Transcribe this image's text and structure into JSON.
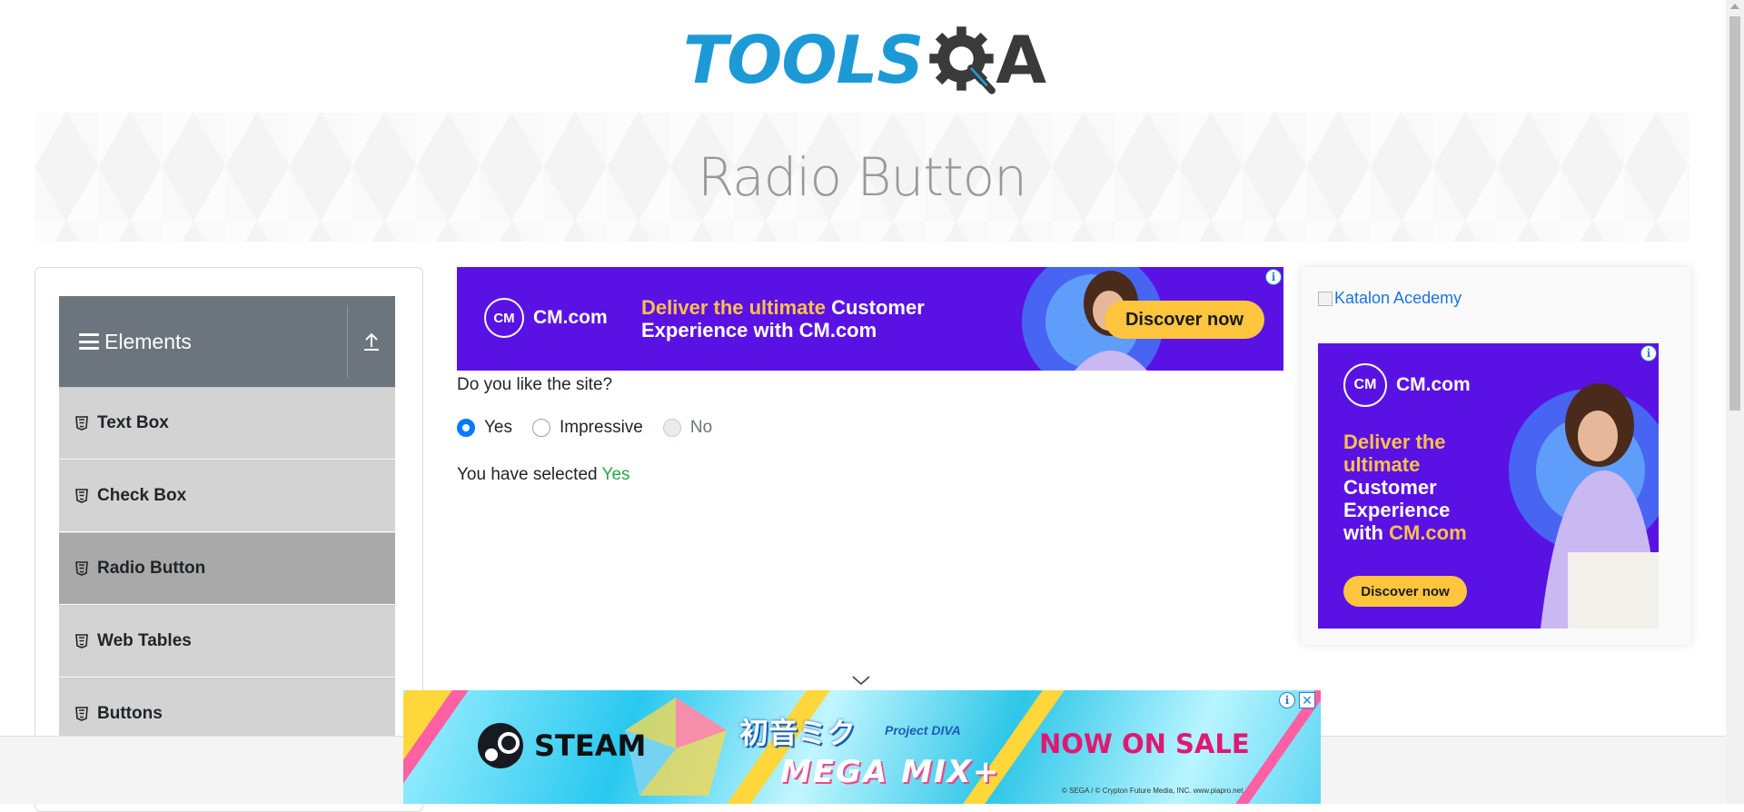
{
  "header": {
    "logo_text": "TOOLS",
    "logo_suffix": "A",
    "logo_letter_icon": "gear-q-icon"
  },
  "banner": {
    "title": "Radio Button"
  },
  "sidebar": {
    "group": {
      "label": "Elements",
      "icon": "hamburger-icon",
      "collapse_icon": "upload-arrow-icon"
    },
    "items": [
      {
        "label": "Text Box",
        "icon": "html5-icon",
        "active": false
      },
      {
        "label": "Check Box",
        "icon": "html5-icon",
        "active": false
      },
      {
        "label": "Radio Button",
        "icon": "html5-icon",
        "active": true
      },
      {
        "label": "Web Tables",
        "icon": "html5-icon",
        "active": false
      },
      {
        "label": "Buttons",
        "icon": "html5-icon",
        "active": false
      }
    ]
  },
  "top_ad": {
    "brand": "CM.com",
    "brand_mark": "CM",
    "headline_1a": "Deliver the ultimate ",
    "headline_1b": "Customer",
    "headline_2a": "Experience ",
    "headline_2b": "with CM.com",
    "cta": "Discover now",
    "info": "i"
  },
  "form": {
    "question": "Do you like the site?",
    "options": [
      {
        "label": "Yes",
        "checked": true,
        "disabled": false
      },
      {
        "label": "Impressive",
        "checked": false,
        "disabled": false
      },
      {
        "label": "No",
        "checked": false,
        "disabled": true
      }
    ],
    "result_prefix": "You have selected ",
    "result_value": "Yes"
  },
  "right_panel": {
    "image_alt": "Katalon Acedemy",
    "ad": {
      "brand": "CM.com",
      "brand_mark": "CM",
      "line1": "Deliver the",
      "line2": "ultimate",
      "line3": "Customer",
      "line4": "Experience",
      "line5a": "with ",
      "line5b": "CM.com",
      "cta": "Discover now",
      "info": "i"
    }
  },
  "bottom_ad": {
    "steam": "STEAM",
    "game_jp": "初音ミク",
    "game_sub": "Project DIVA",
    "game_title": "MEGA MIX+",
    "sale": "NOW ON SALE",
    "copyright": "© SEGA / © Crypton Future Media, INC. www.piapro.net",
    "close": "✕",
    "info": "i"
  },
  "colors": {
    "accent": "#007bff",
    "selected_text": "#28a745",
    "sidebar_header": "#6c757d",
    "sidebar_item": "#d3d3d3",
    "sidebar_active": "#a9a9a9",
    "ad_purple": "#5a12e4",
    "ad_yellow": "#ffc53d"
  }
}
